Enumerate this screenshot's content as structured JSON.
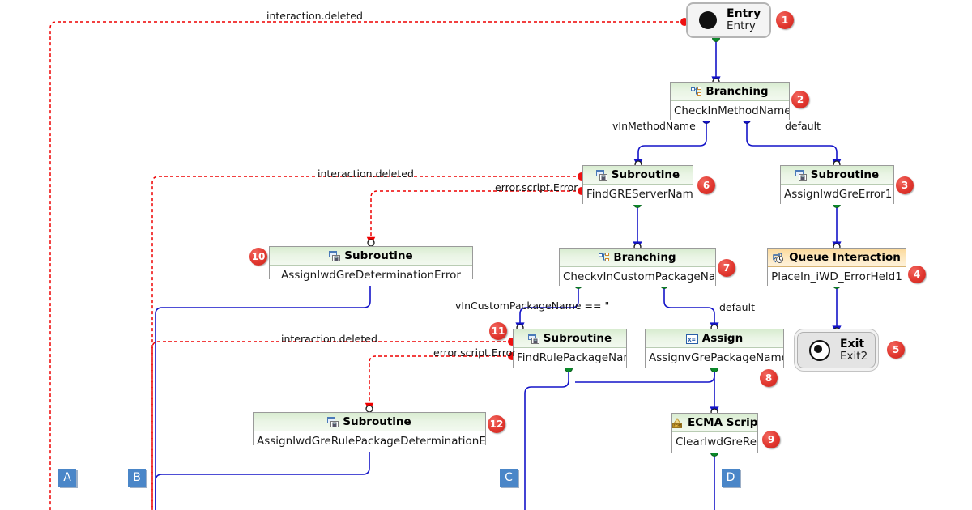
{
  "diagram": {
    "type": "workflow-flowchart",
    "background": "#ffffff",
    "colors": {
      "primary_link": "#1414c8",
      "error_link": "#ee0000",
      "node_header_green": "#d8ecd0",
      "node_header_orange": "#fbd99a",
      "badge_red": "#d42e26",
      "marker_blue": "#4a86c8"
    }
  },
  "nodes": [
    {
      "id": 1,
      "badge": "1",
      "kind": "Entry",
      "type_label": "Entry",
      "name": "Entry"
    },
    {
      "id": 2,
      "badge": "2",
      "kind": "Branching",
      "type_label": "Branching",
      "name": "CheckInMethodName"
    },
    {
      "id": 3,
      "badge": "3",
      "kind": "Subroutine",
      "type_label": "Subroutine",
      "name": "AssignIwdGreError1"
    },
    {
      "id": 4,
      "badge": "4",
      "kind": "QueueInteraction",
      "type_label": "Queue Interaction",
      "name": "PlaceIn_iWD_ErrorHeld1"
    },
    {
      "id": 5,
      "badge": "5",
      "kind": "Exit",
      "type_label": "Exit",
      "name": "Exit2"
    },
    {
      "id": 6,
      "badge": "6",
      "kind": "Subroutine",
      "type_label": "Subroutine",
      "name": "FindGREServerName"
    },
    {
      "id": 7,
      "badge": "7",
      "kind": "Branching",
      "type_label": "Branching",
      "name": "CheckvInCustomPackageNa..."
    },
    {
      "id": 8,
      "badge": "8",
      "kind": "Assign",
      "type_label": "Assign",
      "name": "AssignvGrePackageName"
    },
    {
      "id": 9,
      "badge": "9",
      "kind": "ECMAScript",
      "type_label": "ECMA Script",
      "name": "ClearIwdGreResult"
    },
    {
      "id": 10,
      "badge": "10",
      "kind": "Subroutine",
      "type_label": "Subroutine",
      "name": "AssignIwdGreDeterminationError"
    },
    {
      "id": 11,
      "badge": "11",
      "kind": "Subroutine",
      "type_label": "Subroutine",
      "name": "FindRulePackageName"
    },
    {
      "id": 12,
      "badge": "12",
      "kind": "Subroutine",
      "type_label": "Subroutine",
      "name": "AssignIwdGreRulePackageDeterminationError"
    }
  ],
  "edge_labels": {
    "top_interaction_deleted": "interaction.deleted",
    "branch_vinmethodname": "vInMethodName",
    "branch_default_1": "default",
    "mid_interaction_deleted": "interaction.deleted",
    "mid_error_script": "error.script.Error",
    "branch_vincustompackagename": "vInCustomPackageName == \"",
    "branch_default_2": "default",
    "low_interaction_deleted": "interaction.deleted",
    "low_error_script": "error.script.Error"
  },
  "markers": [
    {
      "letter": "A"
    },
    {
      "letter": "B"
    },
    {
      "letter": "C"
    },
    {
      "letter": "D"
    }
  ]
}
